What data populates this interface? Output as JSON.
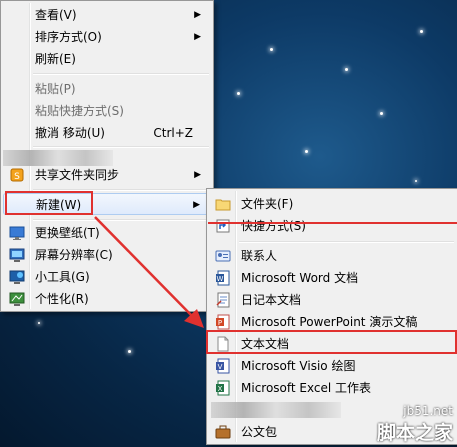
{
  "main_menu": {
    "view": "查看(V)",
    "sort": "排序方式(O)",
    "refresh": "刷新(E)",
    "paste": "粘贴(P)",
    "paste_shortcut": "粘贴快捷方式(S)",
    "undo": "撤消 移动(U)",
    "undo_shortcut": "Ctrl+Z",
    "share_sync": "共享文件夹同步",
    "new": "新建(W)",
    "wallpaper": "更换壁纸(T)",
    "resolution": "屏幕分辨率(C)",
    "gadgets": "小工具(G)",
    "personalize": "个性化(R)"
  },
  "new_submenu": {
    "folder": "文件夹(F)",
    "shortcut": "快捷方式(S)",
    "contact": "联系人",
    "word": "Microsoft Word 文档",
    "journal": "日记本文档",
    "powerpoint": "Microsoft PowerPoint 演示文稿",
    "text": "文本文档",
    "visio": "Microsoft Visio 绘图",
    "excel": "Microsoft Excel 工作表",
    "briefcase": "公文包"
  },
  "watermark": {
    "url": "jb51.net",
    "name": "脚本之家"
  },
  "colors": {
    "highlight_red": "#e0312f",
    "menu_bg": "#f0f0f0",
    "desktop_blue": "#0d3a66"
  }
}
